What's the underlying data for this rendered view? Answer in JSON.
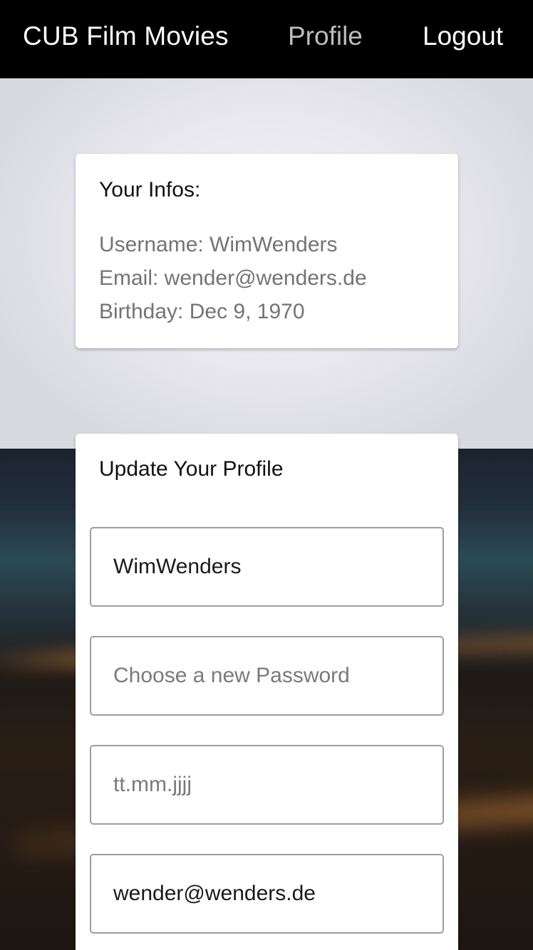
{
  "navbar": {
    "brand": "CUB Film Movies",
    "profile_label": "Profile",
    "logout_label": "Logout"
  },
  "info_card": {
    "title": "Your Infos:",
    "username_line": "Username: WimWenders",
    "email_line": "Email: wender@wenders.de",
    "birthday_line": "Birthday: Dec 9, 1970"
  },
  "update_card": {
    "title": "Update Your Profile",
    "username_value": "WimWenders",
    "password_placeholder": "Choose a new Password",
    "birthday_placeholder": "tt.mm.jjjj",
    "email_value": "wender@wenders.de"
  },
  "colors": {
    "navbar_bg": "#000000",
    "nav_active": "#bdbdbd",
    "nav_text": "#ffffff",
    "card_bg": "#ffffff",
    "muted_text": "#747474"
  }
}
